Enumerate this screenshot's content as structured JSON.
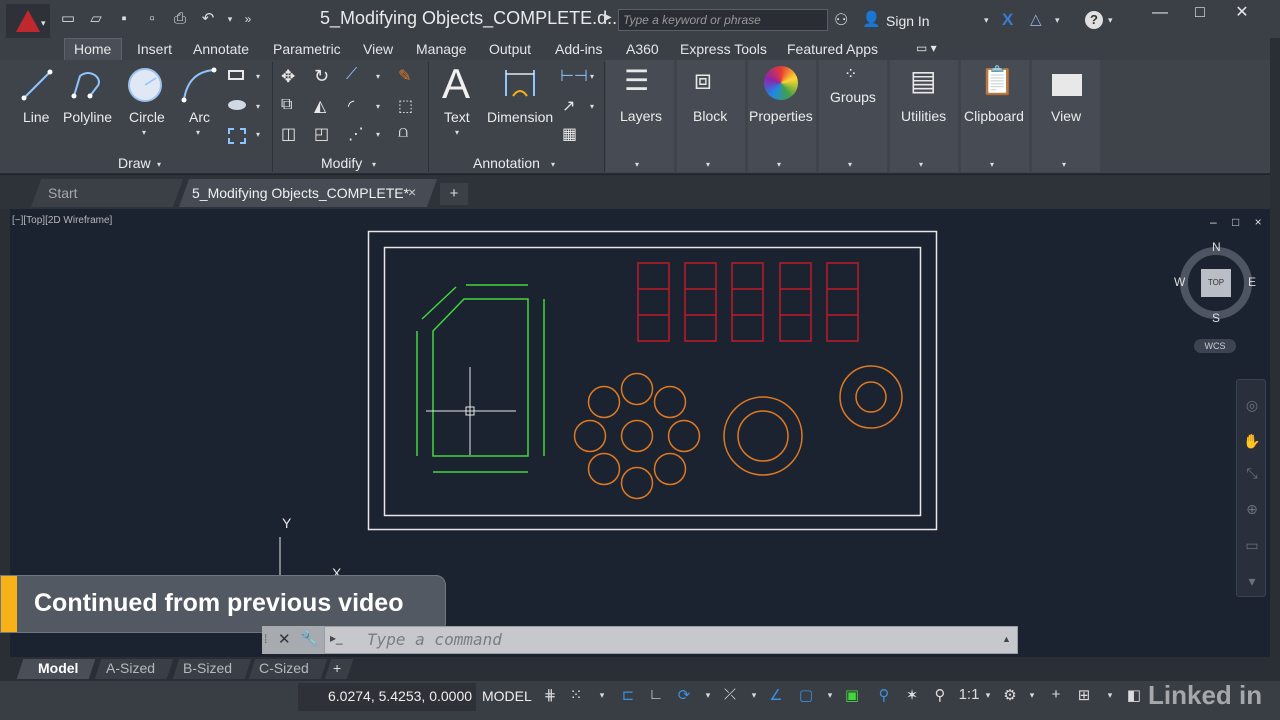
{
  "title_bar": {
    "document_title": "5_Modifying Objects_COMPLETE.d...",
    "search_placeholder": "Type a keyword or phrase",
    "sign_in": "Sign In",
    "quick_access_icons": [
      "new-icon",
      "open-icon",
      "save-icon",
      "save-as-icon",
      "print-icon",
      "undo-icon",
      "more-icon"
    ],
    "window_controls": [
      "minimize-icon",
      "maximize-icon",
      "close-icon"
    ]
  },
  "ribbon_tabs": [
    "Home",
    "Insert",
    "Annotate",
    "Parametric",
    "View",
    "Manage",
    "Output",
    "Add-ins",
    "A360",
    "Express Tools",
    "Featured Apps"
  ],
  "ribbon": {
    "draw": {
      "panel_label": "Draw",
      "tools": [
        "Line",
        "Polyline",
        "Circle",
        "Arc"
      ]
    },
    "modify": {
      "panel_label": "Modify"
    },
    "annotation": {
      "panel_label": "Annotation",
      "tools": [
        "Text",
        "Dimension"
      ]
    },
    "groups": [
      "Layers",
      "Block",
      "Properties",
      "Groups",
      "Utilities",
      "Clipboard",
      "View"
    ]
  },
  "file_tabs": {
    "start": "Start",
    "active": "5_Modifying Objects_COMPLETE*",
    "close": "×",
    "add": "+"
  },
  "viewport": {
    "label": "[−][Top][2D Wireframe]",
    "controls": "– □ ×",
    "viewcube": {
      "n": "N",
      "s": "S",
      "e": "E",
      "w": "W",
      "face": "TOP",
      "wcs": "WCS"
    },
    "ucs": {
      "y": "Y",
      "x": "X"
    }
  },
  "banner": {
    "text": "Continued from previous video",
    "accent_color": "#f7b21a"
  },
  "command_line": {
    "placeholder": "Type a command",
    "prompt_icon": "▸_"
  },
  "layout_tabs": [
    "Model",
    "A-Sized",
    "B-Sized",
    "C-Sized"
  ],
  "status_bar": {
    "coordinates": "6.0274, 5.4253, 0.0000",
    "model": "MODEL",
    "scale": "1:1",
    "watermark": "Linked in"
  },
  "colors": {
    "background": "#1b2230",
    "green_geometry": "#44d63c",
    "red_geometry": "#c01a28",
    "orange_geometry": "#e07a22",
    "white_geometry": "#e6e6e6"
  }
}
